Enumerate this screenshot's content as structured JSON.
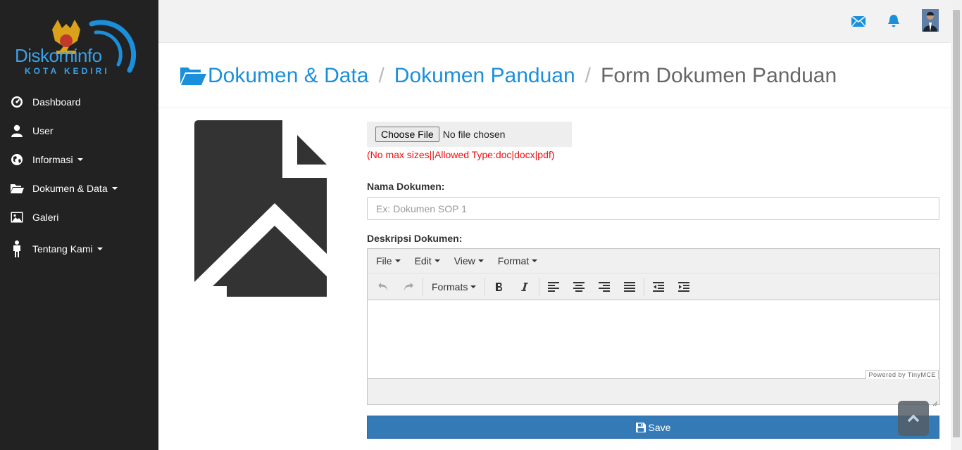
{
  "brand": {
    "name": "Diskominfo",
    "sub": "KOTA KEDIRI"
  },
  "sidebar": {
    "items": [
      {
        "label": "Dashboard",
        "icon": "dashboard-icon",
        "dropdown": false
      },
      {
        "label": "User",
        "icon": "user-icon",
        "dropdown": false
      },
      {
        "label": "Informasi",
        "icon": "globe-icon",
        "dropdown": true
      },
      {
        "label": "Dokumen & Data",
        "icon": "folder-open-icon",
        "dropdown": true
      },
      {
        "label": "Galeri",
        "icon": "picture-icon",
        "dropdown": false
      },
      {
        "label": "Tentang Kami",
        "icon": "person-icon",
        "dropdown": true
      }
    ]
  },
  "topbar": {
    "icons": [
      "envelope-icon",
      "bell-icon",
      "avatar"
    ]
  },
  "breadcrumb": {
    "items": [
      "Dokumen & Data",
      "Dokumen Panduan"
    ],
    "current": "Form Dokumen Panduan",
    "separator": "/"
  },
  "form": {
    "file": {
      "button_label": "Choose File",
      "status": "No file chosen",
      "hint": "(No max sizes||Allowed Type:doc|docx|pdf)"
    },
    "name": {
      "label": "Nama Dokumen:",
      "placeholder": "Ex: Dokumen SOP 1",
      "value": ""
    },
    "description": {
      "label": "Deskripsi Dokumen:"
    },
    "save_label": "Save"
  },
  "editor": {
    "menus": [
      "File",
      "Edit",
      "View",
      "Format"
    ],
    "formats_label": "Formats",
    "powered_by": "Powered by TinyMCE"
  },
  "colors": {
    "sidebar_bg": "#222222",
    "accent": "#1a8fdc",
    "button": "#337ab7",
    "hint": "#ee1111"
  }
}
